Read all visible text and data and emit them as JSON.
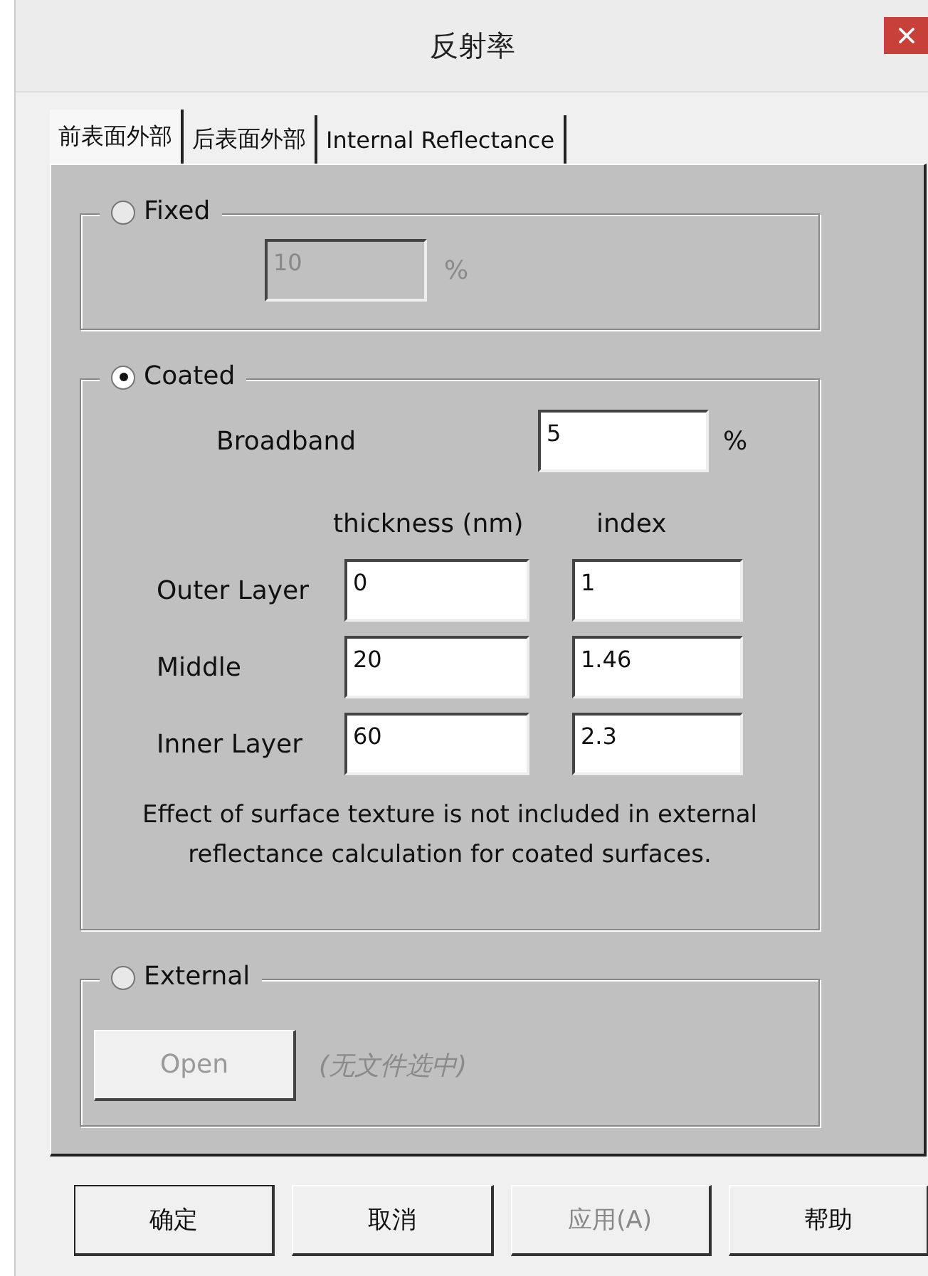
{
  "window": {
    "title": "反射率"
  },
  "tabs": [
    {
      "label": "前表面外部",
      "selected": true
    },
    {
      "label": "后表面外部",
      "selected": false
    },
    {
      "label": "Internal Reflectance",
      "selected": false
    }
  ],
  "groups": [
    {
      "kind": "fixed",
      "label": "Fixed",
      "selected": false,
      "disabled": true,
      "value": "10",
      "unit": "%"
    },
    {
      "kind": "coated",
      "label": "Coated",
      "selected": true,
      "disabled": false,
      "broadband_label": "Broadband",
      "broadband_value": "5",
      "unit": "%",
      "columns": [
        "thickness (nm)",
        "index"
      ],
      "layers": [
        {
          "name": "Outer Layer",
          "thickness": "0",
          "index": "1"
        },
        {
          "name": "Middle",
          "thickness": "20",
          "index": "1.46"
        },
        {
          "name": "Inner Layer",
          "thickness": "60",
          "index": "2.3"
        }
      ],
      "note": "Effect of surface texture is not included in external reflectance calculation for coated surfaces."
    },
    {
      "kind": "external",
      "label": "External",
      "selected": false,
      "disabled": true,
      "button": "Open",
      "file": "(无文件选中)"
    }
  ],
  "buttons": [
    {
      "label": "确定",
      "default": true,
      "disabled": false
    },
    {
      "label": "取消",
      "default": false,
      "disabled": false
    },
    {
      "label": "应用(A)",
      "default": false,
      "disabled": true
    },
    {
      "label": "帮助",
      "default": false,
      "disabled": false
    }
  ]
}
